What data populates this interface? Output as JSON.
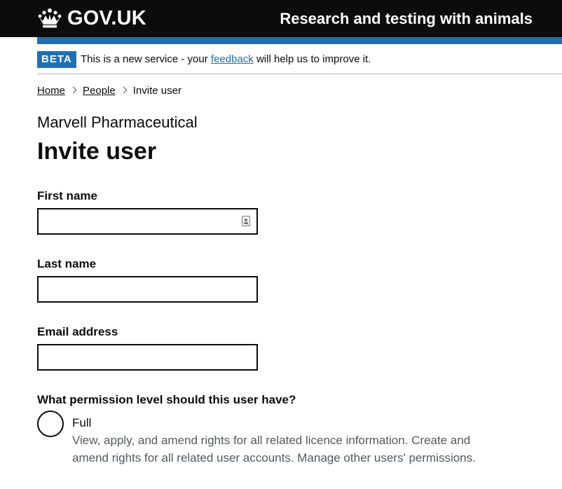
{
  "header": {
    "logo_text": "GOV.UK",
    "service_name": "Research and testing with animals"
  },
  "phase_banner": {
    "tag": "BETA",
    "text_before": "This is a new service - your",
    "link": "feedback",
    "text_after": "will help us to improve it."
  },
  "breadcrumbs": [
    {
      "label": "Home"
    },
    {
      "label": "People"
    },
    {
      "label": "Invite user"
    }
  ],
  "page": {
    "caption": "Marvell Pharmaceutical",
    "title": "Invite user"
  },
  "form": {
    "first_name": {
      "label": "First name",
      "value": ""
    },
    "last_name": {
      "label": "Last name",
      "value": ""
    },
    "email": {
      "label": "Email address",
      "value": ""
    },
    "permission": {
      "legend": "What permission level should this user have?",
      "options": [
        {
          "label": "Full",
          "hint": "View, apply, and amend rights for all related licence information. Create and amend rights for all related user accounts. Manage other users' permissions.",
          "checked": false
        }
      ]
    }
  },
  "colors": {
    "header_bg": "#0b0c0c",
    "stripe": "#1d70b8",
    "link": "#1d70b8",
    "hint": "#505a5f"
  },
  "icons": [
    "crown-icon",
    "chevron-right-icon",
    "autofill-contact-icon"
  ]
}
